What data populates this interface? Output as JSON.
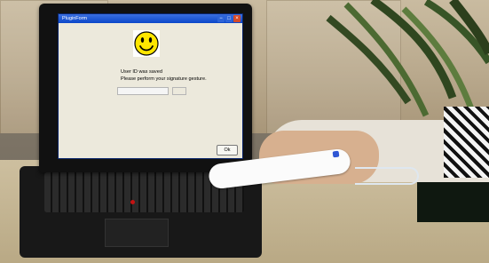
{
  "app": {
    "title": "PluginForm"
  },
  "dialog": {
    "message_line_1": "User ID was saved",
    "message_line_2": "Please perform your signature gesture.",
    "ok_label": "Ok",
    "gesture_input_value": "",
    "gesture_button_label": ""
  },
  "icons": {
    "smiley": "smiley-face-icon",
    "minimize": "minimize-icon",
    "maximize": "maximize-icon",
    "close": "close-icon"
  },
  "colors": {
    "titlebar": "#0b47c9",
    "dialog_bg": "#ece9dc",
    "remote_accent": "#2f56d4",
    "trackpoint": "#c41212"
  }
}
